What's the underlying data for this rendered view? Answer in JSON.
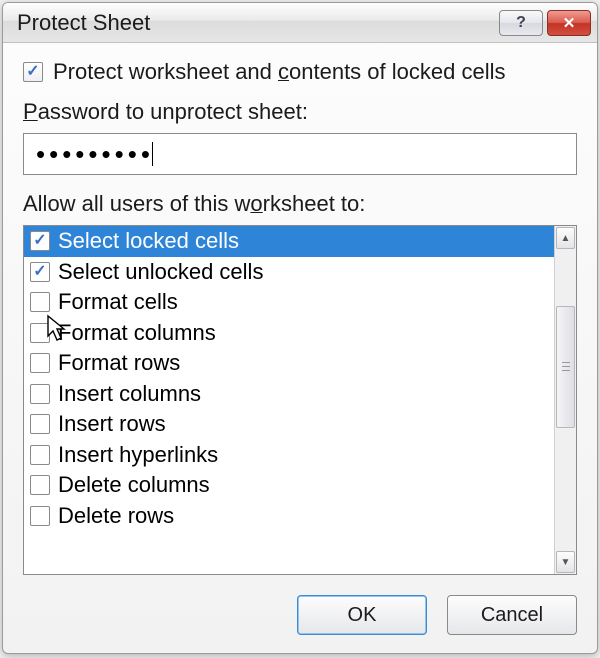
{
  "title": "Protect Sheet",
  "protectCheckbox": {
    "checked": true,
    "labelPrefix": "Protect worksheet and ",
    "labelUnderline": "c",
    "labelSuffix": "ontents of locked cells"
  },
  "passwordLabel": {
    "underline": "P",
    "rest": "assword to unprotect sheet:"
  },
  "passwordValue": "•••••••••",
  "allowLabel": {
    "prefix": "Allow all users of this w",
    "underline": "o",
    "suffix": "rksheet to:"
  },
  "permissions": [
    {
      "label": "Select locked cells",
      "checked": true,
      "selected": true
    },
    {
      "label": "Select unlocked cells",
      "checked": true,
      "selected": false
    },
    {
      "label": "Format cells",
      "checked": false,
      "selected": false
    },
    {
      "label": "Format columns",
      "checked": false,
      "selected": false
    },
    {
      "label": "Format rows",
      "checked": false,
      "selected": false
    },
    {
      "label": "Insert columns",
      "checked": false,
      "selected": false
    },
    {
      "label": "Insert rows",
      "checked": false,
      "selected": false
    },
    {
      "label": "Insert hyperlinks",
      "checked": false,
      "selected": false
    },
    {
      "label": "Delete columns",
      "checked": false,
      "selected": false
    },
    {
      "label": "Delete rows",
      "checked": false,
      "selected": false
    }
  ],
  "buttons": {
    "ok": "OK",
    "cancel": "Cancel"
  },
  "titlebar": {
    "help": "?",
    "close": "✕"
  }
}
